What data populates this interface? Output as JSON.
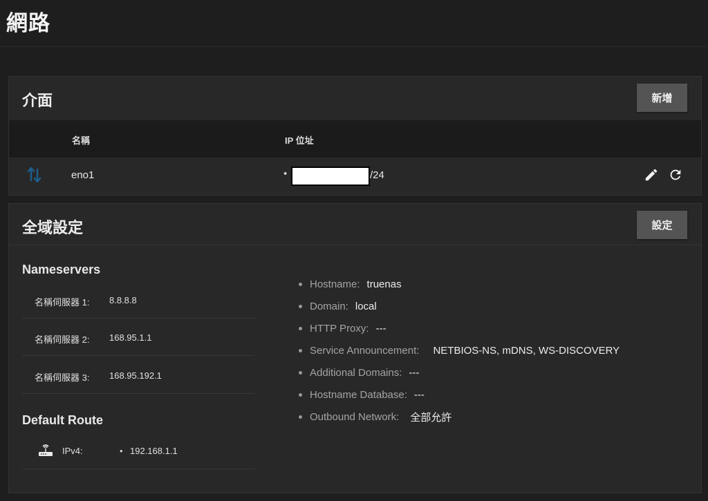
{
  "page": {
    "title": "網路"
  },
  "interfaces": {
    "title": "介面",
    "add_label": "新增",
    "columns": {
      "name": "名稱",
      "ip": "IP 位址"
    },
    "rows": [
      {
        "name": "eno1",
        "ip_suffix": "/24"
      }
    ]
  },
  "global": {
    "title": "全域設定",
    "settings_label": "設定",
    "nameservers": {
      "heading": "Nameservers",
      "items": [
        {
          "label": "名稱伺服器 1:",
          "value": "8.8.8.8"
        },
        {
          "label": "名稱伺服器 2:",
          "value": "168.95.1.1"
        },
        {
          "label": "名稱伺服器 3:",
          "value": "168.95.192.1"
        }
      ]
    },
    "default_route": {
      "heading": "Default Route",
      "label": "IPv4:",
      "value": "192.168.1.1"
    },
    "settings": [
      {
        "label": "Hostname:",
        "value": "truenas"
      },
      {
        "label": "Domain:",
        "value": "local"
      },
      {
        "label": "HTTP Proxy:",
        "value": "---"
      },
      {
        "label": "Service Announcement:",
        "value": "NETBIOS-NS, mDNS, WS-DISCOVERY"
      },
      {
        "label": "Additional Domains:",
        "value": "---"
      },
      {
        "label": "Hostname Database:",
        "value": "---"
      },
      {
        "label": "Outbound Network:",
        "value": "全部允許"
      }
    ]
  },
  "colors": {
    "background": "#1e1e1e",
    "card": "#282828",
    "table_header": "#1b1b1b",
    "button": "#545454",
    "link_icon": "#1e5f8c"
  },
  "icons": {
    "interface_status": "arrows-up-down-icon",
    "edit": "pencil-icon",
    "reset": "refresh-icon",
    "router": "router-icon"
  }
}
